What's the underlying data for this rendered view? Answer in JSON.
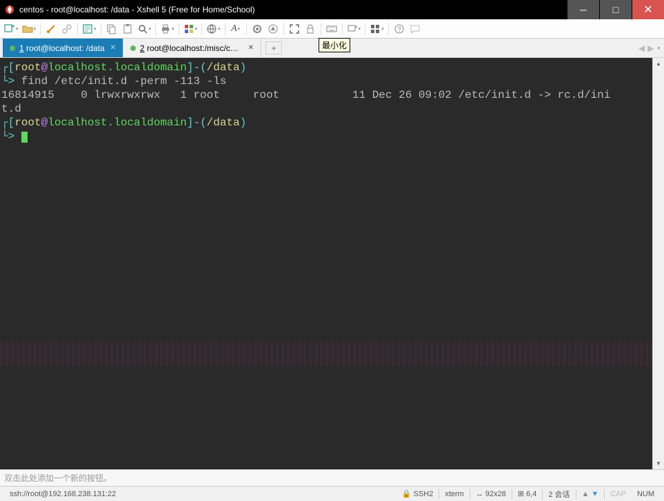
{
  "titlebar": {
    "text": "centos - root@localhost: /data - Xshell 5 (Free for Home/School)"
  },
  "tooltip": "最小化",
  "tabs": [
    {
      "num": "1",
      "rest": " root@localhost: /data",
      "active": true
    },
    {
      "num": "2",
      "rest": " root@localhost:/misc/cd/Pa...",
      "active": false
    }
  ],
  "terminal": {
    "line1_user": "root",
    "line1_at": "@",
    "line1_host": "localhost.localdomain",
    "line1_path": "/data",
    "line2_cmd": " find /etc/init.d -perm -113 -ls",
    "line3_out": "16814915    0 lrwxrwxrwx   1 root     root           11 Dec 26 09:02 /etc/init.d -> rc.d/ini",
    "line4_out": "t.d",
    "line5_user": "root",
    "line5_at": "@",
    "line5_host": "localhost.localdomain",
    "line5_path": "/data"
  },
  "bottom_placeholder": "双击此处添加一个新的按钮。",
  "status": {
    "conn": "ssh://root@192.168.238.131:22",
    "ssh": "SSH2",
    "term": "xterm",
    "size": "92x28",
    "pos": "6,4",
    "sessions": "2 会话",
    "cap": "CAP",
    "num": "NUM"
  }
}
